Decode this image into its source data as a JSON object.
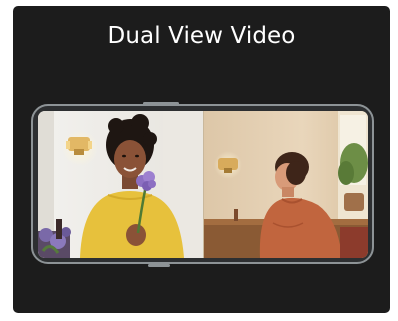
{
  "title": "Dual View Video",
  "colors": {
    "card_background": "#1c1c1c",
    "title_text": "#ffffff",
    "phone_frame": "#8d9396"
  },
  "screen": {
    "left_view": "woman-in-yellow-sweater-holding-flower",
    "right_view": "man-in-orange-sweater-at-table"
  }
}
